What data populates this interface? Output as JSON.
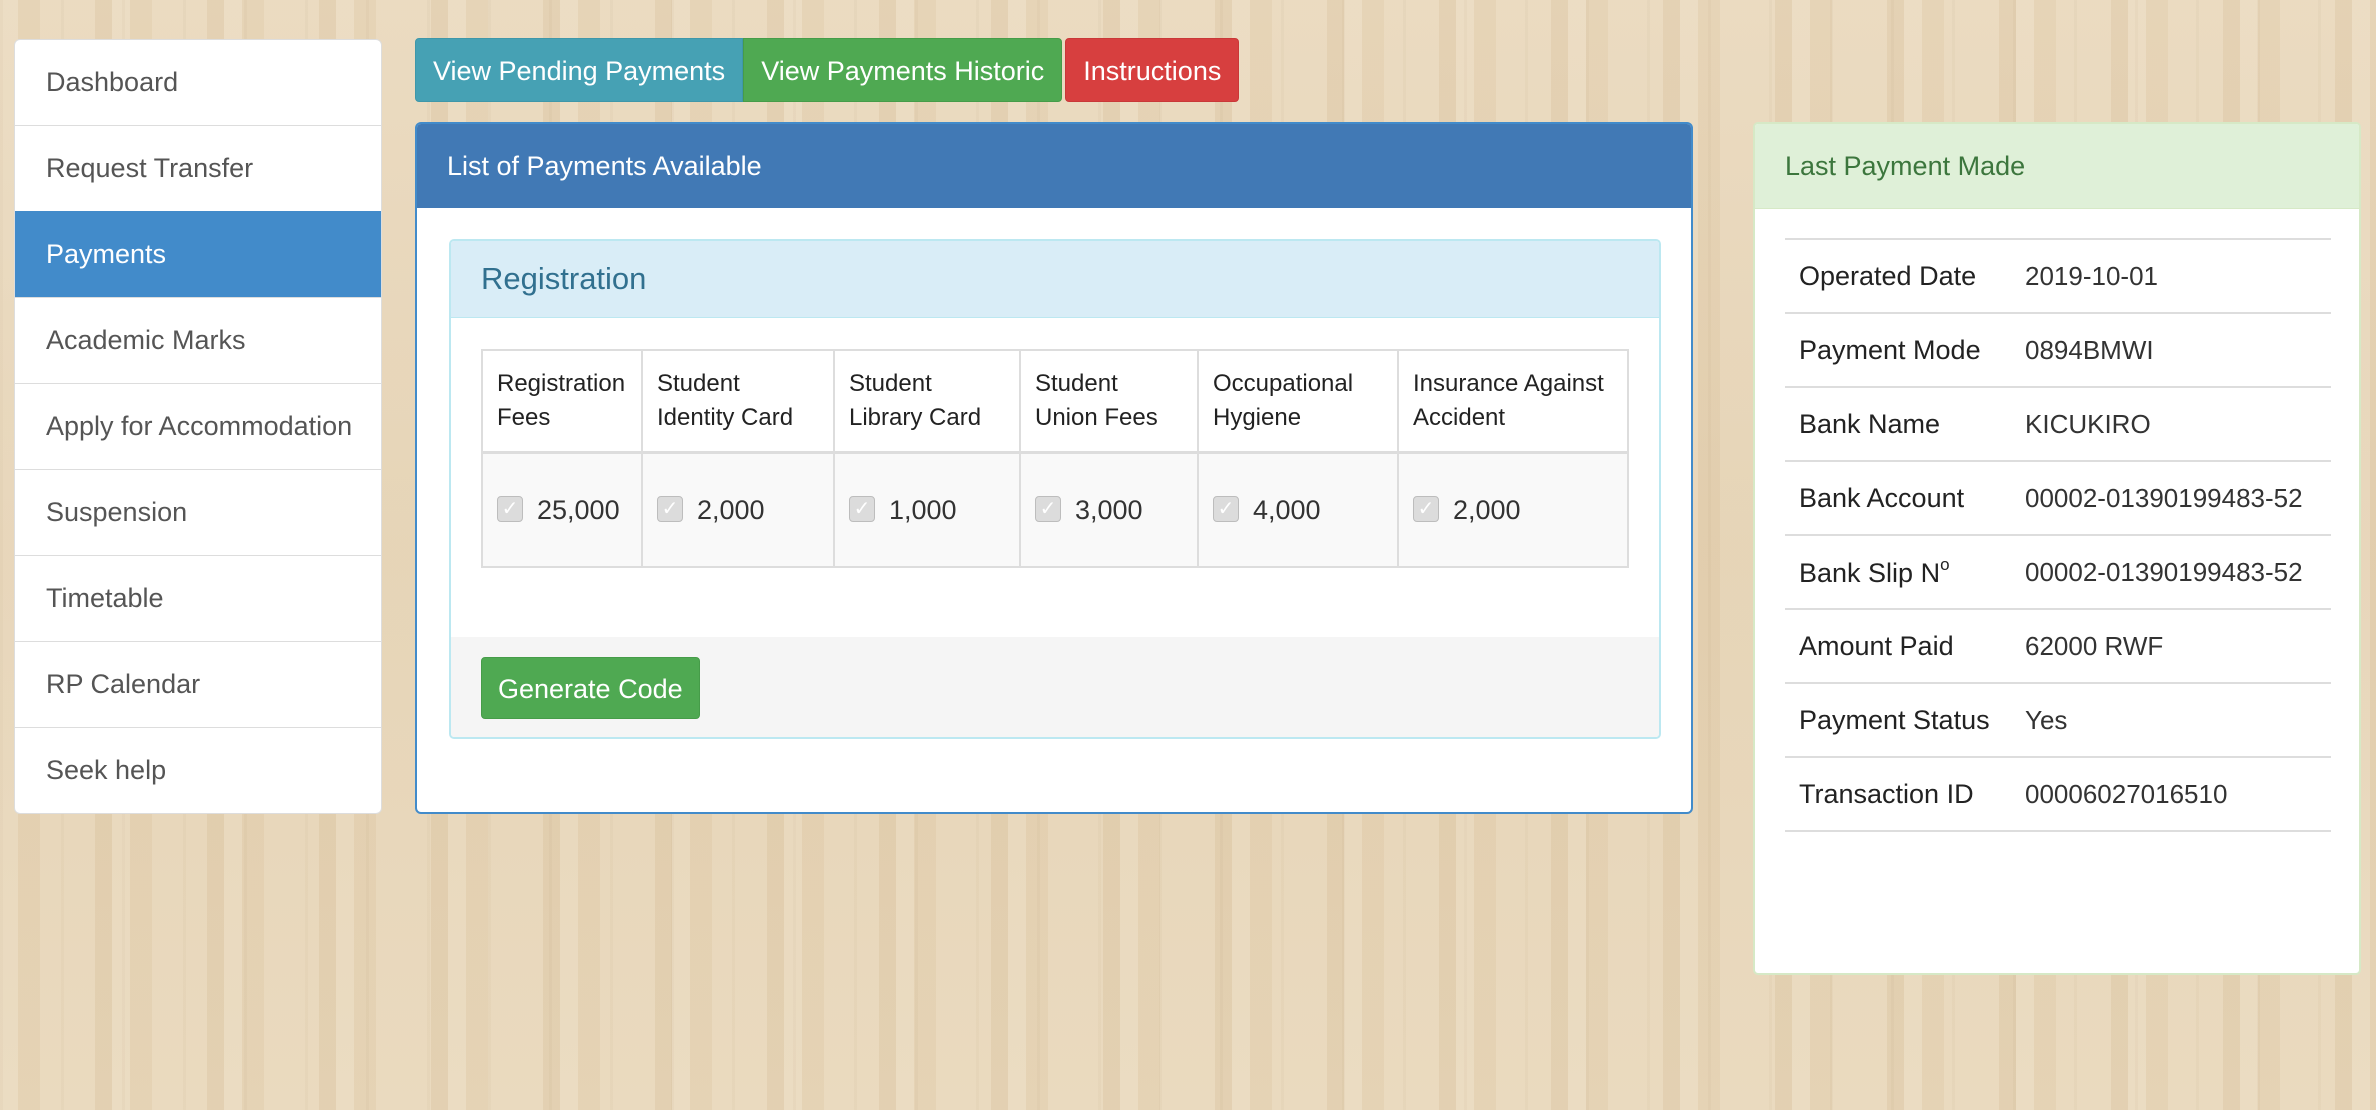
{
  "sidebar": {
    "items": [
      {
        "label": "Dashboard",
        "active": false
      },
      {
        "label": "Request Transfer",
        "active": false
      },
      {
        "label": "Payments",
        "active": true
      },
      {
        "label": "Academic Marks",
        "active": false
      },
      {
        "label": "Apply for Accommodation",
        "active": false
      },
      {
        "label": "Suspension",
        "active": false
      },
      {
        "label": "Timetable",
        "active": false
      },
      {
        "label": "RP Calendar",
        "active": false
      },
      {
        "label": "Seek help",
        "active": false
      }
    ]
  },
  "toolbar": {
    "pending_label": "View Pending Payments",
    "historic_label": "View Payments Historic",
    "instructions_label": "Instructions"
  },
  "main": {
    "title": "List of Payments Available",
    "section_title": "Registration",
    "columns": [
      {
        "header": [
          "Registration",
          "Fees"
        ],
        "amount": "25,000",
        "checked": true
      },
      {
        "header": [
          "Student",
          "Identity Card"
        ],
        "amount": "2,000",
        "checked": true
      },
      {
        "header": [
          "Student",
          "Library Card"
        ],
        "amount": "1,000",
        "checked": true
      },
      {
        "header": [
          "Student",
          "Union Fees"
        ],
        "amount": "3,000",
        "checked": true
      },
      {
        "header": [
          "Occupational",
          "Hygiene"
        ],
        "amount": "4,000",
        "checked": true
      },
      {
        "header": [
          "Insurance Against",
          "Accident"
        ],
        "amount": "2,000",
        "checked": true
      }
    ],
    "generate_label": "Generate Code"
  },
  "last_payment": {
    "title": "Last Payment Made",
    "rows": [
      {
        "label": "Operated Date",
        "value": "2019-10-01"
      },
      {
        "label": "Payment Mode",
        "value": "0894BMWI"
      },
      {
        "label": "Bank Name",
        "value": "KICUKIRO"
      },
      {
        "label": "Bank Account",
        "value": "00002-01390199483-52"
      },
      {
        "label": "Bank Slip N",
        "sup": "o",
        "value": "00002-01390199483-52"
      },
      {
        "label": "Amount Paid",
        "value": "62000 RWF"
      },
      {
        "label": "Payment Status",
        "value": "Yes"
      },
      {
        "label": "Transaction ID",
        "value": "00006027016510"
      }
    ]
  },
  "colors": {
    "primary": "#428bca",
    "info": "#46a1b4",
    "success": "#4fa952",
    "danger": "#d73f3f"
  },
  "icons": {
    "checkbox": "checkbox-checked-icon"
  }
}
